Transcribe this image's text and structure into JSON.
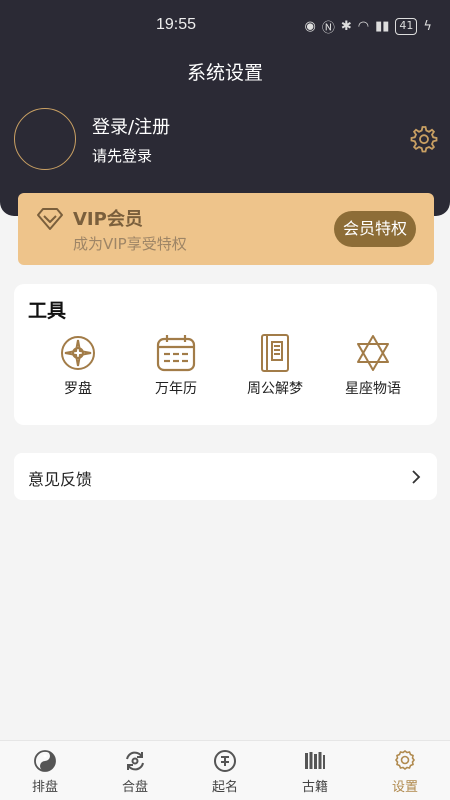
{
  "status_bar": {
    "time": "19:55",
    "battery": "41"
  },
  "header": {
    "title": "系统设置",
    "login_title": "登录/注册",
    "login_subtitle": "请先登录"
  },
  "vip": {
    "title": "VIP会员",
    "subtitle": "成为VIP享受特权",
    "button_label": "会员特权"
  },
  "tools": {
    "title": "工具",
    "items": [
      {
        "label": "罗盘",
        "icon": "compass-icon"
      },
      {
        "label": "万年历",
        "icon": "calendar-icon"
      },
      {
        "label": "周公解梦",
        "icon": "book-icon"
      },
      {
        "label": "星座物语",
        "icon": "star-of-david-icon"
      }
    ]
  },
  "feedback": {
    "label": "意见反馈"
  },
  "bottom_nav": {
    "items": [
      {
        "label": "排盘",
        "icon": "yin-yang-icon"
      },
      {
        "label": "合盘",
        "icon": "refresh-icon"
      },
      {
        "label": "起名",
        "icon": "name-icon"
      },
      {
        "label": "古籍",
        "icon": "bookshelf-icon"
      },
      {
        "label": "设置",
        "icon": "settings-icon"
      }
    ],
    "active": "设置"
  },
  "colors": {
    "header_bg": "#2b2a35",
    "accent_gold": "#c9a063",
    "vip_bg": "#eec48b",
    "vip_button": "#8d6d37"
  }
}
